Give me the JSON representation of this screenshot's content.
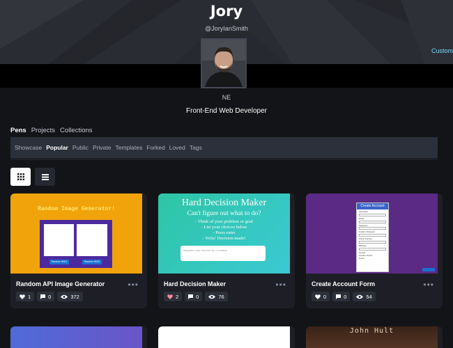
{
  "profile": {
    "name": "Jory",
    "handle": "@JoryIanSmith",
    "customize_label": "Customi",
    "location": "NE",
    "bio": "Front-End Web Developer"
  },
  "tabs": [
    "Pens",
    "Projects",
    "Collections"
  ],
  "subnav": [
    "Showcase",
    "Popular",
    "Public",
    "Private",
    "Templates",
    "Forked",
    "Loved",
    "Tags"
  ],
  "active_subnav": "Popular",
  "view_modes": [
    "grid-icon",
    "list-icon"
  ],
  "pens": [
    {
      "title": "Random API Image Generator",
      "loves": "1",
      "comments": "0",
      "views": "372",
      "loved": false,
      "preview": {
        "heading": "Random Image Generator!",
        "button1": "Random IMG1",
        "button2": "Random IMG2"
      }
    },
    {
      "title": "Hard Decision Maker",
      "loves": "2",
      "comments": "0",
      "views": "76",
      "loved": true,
      "preview": {
        "heading": "Hard Decision Maker",
        "subheading": "Can't figure out what to do?",
        "steps": [
          "- Think of your problem or goal",
          "- List your choices below",
          "- Press enter",
          "- Voila! Decision made!"
        ],
        "input_placeholder": "Separate your choices by a comma"
      }
    },
    {
      "title": "Create Account Form",
      "loves": "0",
      "comments": "0",
      "views": "54",
      "loved": false,
      "preview": {
        "heading": "Create Account",
        "fields": [
          "Username",
          "Email",
          "Password",
          "Confirm Password",
          "Phone Number",
          "Birthday",
          "Gender",
          "Another Choice",
          "Terms"
        ]
      }
    }
  ],
  "second_row": [
    {
      "preview_label": ""
    },
    {
      "preview_label": ""
    },
    {
      "preview_label": "John Hult"
    }
  ],
  "colors": {
    "background": "#131417",
    "card": "#1e1f26",
    "subnav": "#2c303a",
    "love": "#ff3c41",
    "accent": "#76daff"
  }
}
